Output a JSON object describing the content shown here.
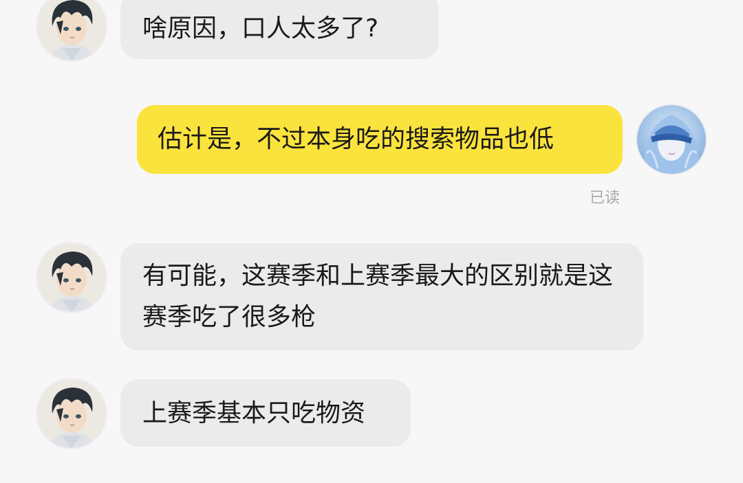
{
  "conversation": {
    "messages": [
      {
        "sender": "other",
        "text": "啥原因，口人太多了?"
      },
      {
        "sender": "self",
        "text": "估计是，不过本身吃的搜索物品也低",
        "status": "已读"
      },
      {
        "sender": "other",
        "text": "有可能，这赛季和上赛季最大的区别就是这赛季吃了很多枪"
      },
      {
        "sender": "other",
        "text": "上赛季基本只吃物资"
      }
    ]
  },
  "colors": {
    "background": "#f7f7f7",
    "incoming_bubble": "#ebebeb",
    "outgoing_bubble": "#fbe33d",
    "status_text": "#a8a8a8"
  },
  "icons": {
    "other_avatar": "anime-boy-avatar",
    "self_avatar": "blue-hair-girl-avatar"
  }
}
